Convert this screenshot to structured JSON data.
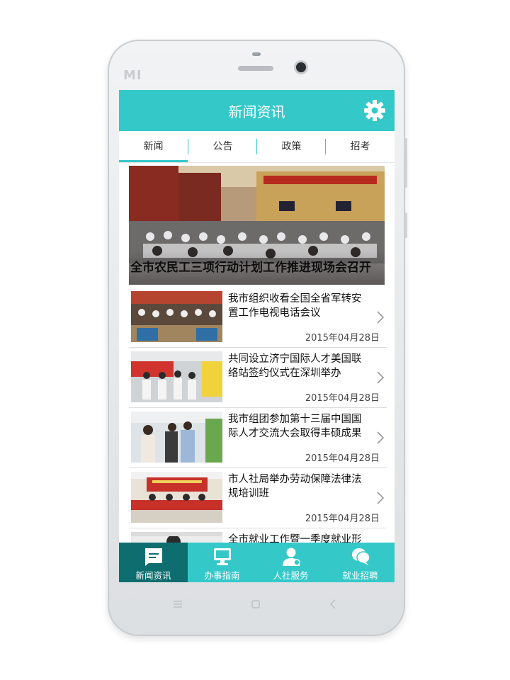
{
  "app": {
    "title": "新闻资讯"
  },
  "tabs": [
    {
      "label": "新闻",
      "active": true
    },
    {
      "label": "公告",
      "active": false
    },
    {
      "label": "政策",
      "active": false
    },
    {
      "label": "招考",
      "active": false
    }
  ],
  "hero": {
    "caption": "全市农民工三项行动计划工作推进现场会召开"
  },
  "news": [
    {
      "title": "我市组织收看全国全省军转安置工作电视电话会议",
      "date": "2015年04月28日"
    },
    {
      "title": "共同设立济宁国际人才美国联络站签约仪式在深圳举办",
      "date": "2015年04月28日"
    },
    {
      "title": "我市组团参加第十三届中国国际人才交流大会取得丰硕成果",
      "date": "2015年04月28日"
    },
    {
      "title": "市人社局举办劳动保障法律法规培训班",
      "date": "2015年04月28日"
    },
    {
      "title": "全市就业工作暨一季度就业形",
      "date": ""
    }
  ],
  "bottom_nav": [
    {
      "label": "新闻资讯",
      "icon": "news-icon",
      "active": true
    },
    {
      "label": "办事指南",
      "icon": "monitor-icon",
      "active": false
    },
    {
      "label": "人社服务",
      "icon": "person-icon",
      "active": false
    },
    {
      "label": "就业招聘",
      "icon": "chat-bubbles-icon",
      "active": false
    }
  ],
  "device": {
    "brand": "MI"
  },
  "colors": {
    "accent": "#35c8c9",
    "accent_dark": "#0e6e6f"
  }
}
